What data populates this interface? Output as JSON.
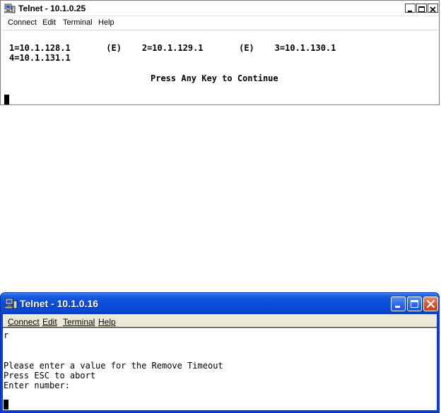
{
  "window1": {
    "title": "Telnet - 10.1.0.25",
    "menu": [
      "Connect",
      "Edit",
      "Terminal",
      "Help"
    ],
    "terminal": {
      "line1": "1=10.1.128.1       (E)    2=10.1.129.1       (E)    3=10.1.130.1",
      "line2": "4=10.1.131.1",
      "prompt": "Press Any Key to Continue"
    }
  },
  "window2": {
    "title": "Telnet - 10.1.0.16",
    "menu": [
      "Connect",
      "Edit",
      "Terminal",
      "Help"
    ],
    "terminal": {
      "line1": "r",
      "line2": "Please enter a value for the Remove Timeout",
      "line3": "Press ESC to abort",
      "line4": "Enter number:"
    }
  },
  "icons": {
    "app": "telnet-computer-icon",
    "minimize": "minimize-icon",
    "maximize": "maximize-icon",
    "close": "close-icon"
  },
  "colors": {
    "xp_title_blue": "#0a4ede",
    "xp_close_red": "#d9512a",
    "menubar_gray": "#ece9d8"
  }
}
